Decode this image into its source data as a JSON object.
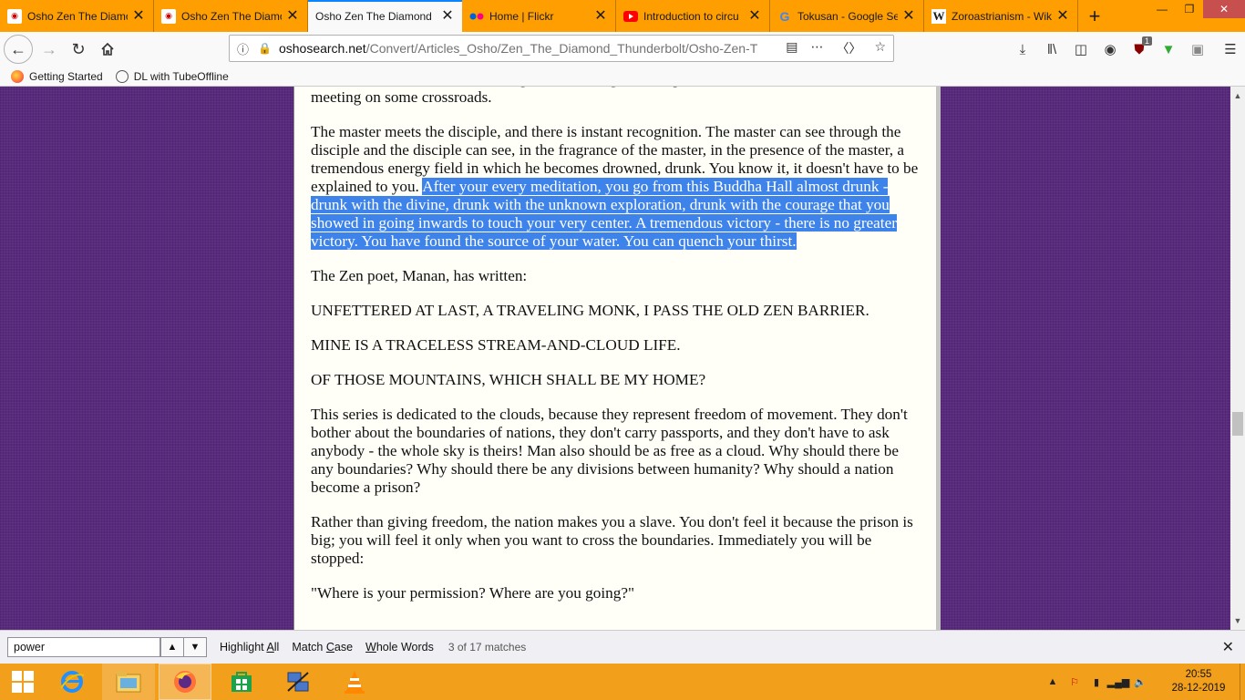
{
  "tabs": [
    {
      "title": "Osho Zen The Diamond",
      "icon": "osho-favicon",
      "active": false
    },
    {
      "title": "Osho Zen The Diamond",
      "icon": "osho-favicon",
      "active": false
    },
    {
      "title": "Osho Zen The Diamond",
      "icon": "osho-favicon",
      "active": true
    },
    {
      "title": "Home | Flickr",
      "icon": "flickr-icon",
      "active": false
    },
    {
      "title": "Introduction to circu",
      "icon": "youtube-icon",
      "active": false
    },
    {
      "title": "Tokusan - Google Se",
      "icon": "google-icon",
      "active": false
    },
    {
      "title": "Zoroastrianism - Wik",
      "icon": "wikipedia-icon",
      "active": false
    }
  ],
  "url": {
    "domain": "oshosearch.net",
    "path": "/Convert/Articles_Osho/Zen_The_Diamond_Thunderbolt/Osho-Zen-T"
  },
  "bookmarks": [
    "Getting Started",
    "DL with TubeOffline"
  ],
  "extension_badge": "1",
  "article": {
    "p_top": "for masters, masters were roaming and searching for disciples. Once in a while there was a meeting on some crossroads.",
    "p1_plain": "The master meets the disciple, and there is instant recognition. The master can see through the disciple and the disciple can see, in the fragrance of the master, in the presence of the master, a tremendous energy field in which he becomes drowned, drunk. You know it, it doesn't have to be explained to you. ",
    "p1_selected": "After your every meditation, you go from this Buddha Hall almost drunk - drunk with the divine, drunk with the unknown exploration, drunk with the courage that you showed in going inwards to touch your very center. A tremendous victory - there is no greater victory. You have found the source of your water. You can quench your thirst. ",
    "p2": "The Zen poet, Manan, has written:",
    "p3": "UNFETTERED AT LAST, A TRAVELING MONK, I PASS THE OLD ZEN BARRIER.",
    "p4": "MINE IS A TRACELESS STREAM-AND-CLOUD LIFE.",
    "p5": "OF THOSE MOUNTAINS, WHICH SHALL BE MY HOME?",
    "p6": "This series is dedicated to the clouds, because they represent freedom of movement. They don't bother about the boundaries of nations, they don't carry passports, and they don't have to ask anybody - the whole sky is theirs! Man also should be as free as a cloud. Why should there be any boundaries? Why should there be any divisions between humanity? Why should a nation become a prison?",
    "p7": "Rather than giving freedom, the nation makes you a slave. You don't feel it because the prison is big; you will feel it only when you want to cross the boundaries. Immediately you will be stopped:",
    "p8": "\"Where is your permission? Where are you going?\""
  },
  "findbar": {
    "query": "power",
    "highlight_all_pre": "Highlight ",
    "highlight_all_key": "A",
    "highlight_all_post": "ll",
    "match_case_pre": "Match ",
    "match_case_key": "C",
    "match_case_post": "ase",
    "whole_words_key": "W",
    "whole_words_post": "hole Words",
    "status": "3 of 17 matches"
  },
  "clock": {
    "time": "20:55",
    "date": "28-12-2019"
  },
  "colors": {
    "accent": "#0a84ff",
    "tabbar": "#ff9e00",
    "taskbar": "#f29f1c",
    "selection": "#3d83ea",
    "background": "#5a2a7e"
  }
}
